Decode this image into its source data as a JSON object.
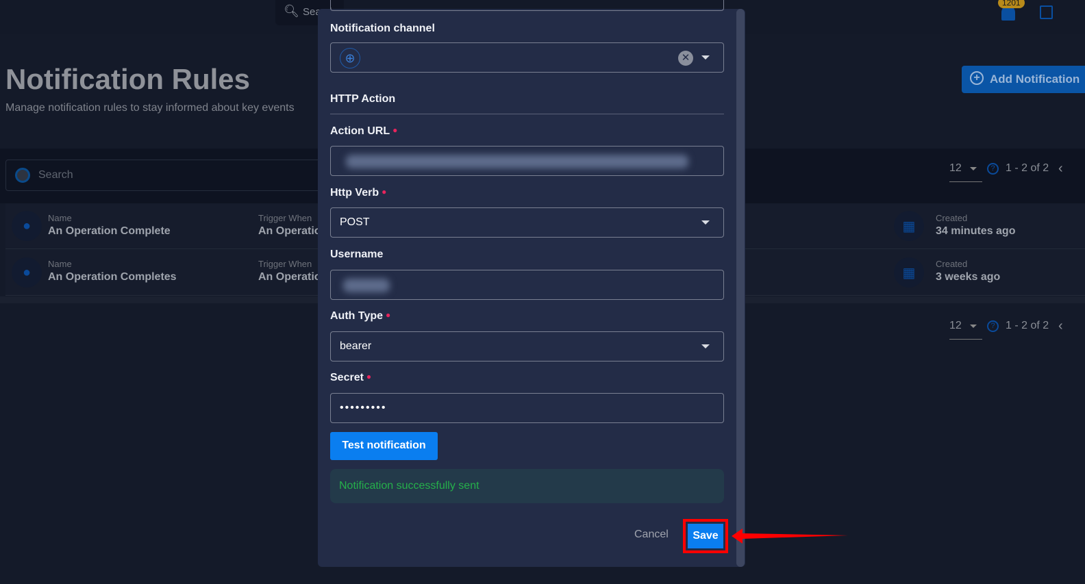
{
  "topbar": {
    "search_placeholder": "Search",
    "notification_count": "1201"
  },
  "page": {
    "title": "Notification Rules",
    "subtitle": "Manage notification rules to stay informed about key events",
    "add_button": "Add Notification"
  },
  "list": {
    "search_placeholder": "Search",
    "page_size": "12",
    "range": "1 - 2 of 2",
    "rows": [
      {
        "name_label": "Name",
        "name": "An Operation Complete",
        "trigger_label": "Trigger When",
        "trigger": "An Operatio",
        "created_label": "Created",
        "created": "34 minutes ago"
      },
      {
        "name_label": "Name",
        "name": "An Operation Completes",
        "trigger_label": "Trigger When",
        "trigger": "An Operatio",
        "created_label": "Created",
        "created": "3 weeks ago"
      }
    ]
  },
  "modal": {
    "channel_label": "Notification channel",
    "section": "HTTP Action",
    "action_url_label": "Action URL",
    "http_verb_label": "Http Verb",
    "http_verb": "POST",
    "username_label": "Username",
    "auth_type_label": "Auth Type",
    "auth_type": "bearer",
    "secret_label": "Secret",
    "secret": "•••••••••",
    "test_button": "Test notification",
    "success_message": "Notification successfully sent",
    "cancel": "Cancel",
    "save": "Save"
  },
  "colors": {
    "primary": "#0a7ef0",
    "success": "#25b04a",
    "required": "#e8245c",
    "highlight": "#ff0000"
  }
}
